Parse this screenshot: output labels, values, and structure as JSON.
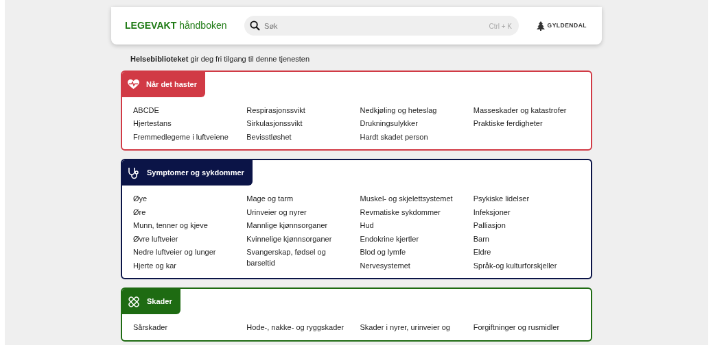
{
  "header": {
    "logo_bold": "LEGEVAKT",
    "logo_light": "håndboken",
    "search": {
      "placeholder": "Søk",
      "shortcut": "Ctrl + K"
    },
    "publisher": "GYLDENDAL"
  },
  "notice": "**Helsebiblioteket** gir deg fri tilgang til denne tjenesten",
  "sections": [
    {
      "title": "Når det haster",
      "kind": "urgent",
      "color": "#d13a45",
      "columns": [
        [
          "ABCDE",
          "Hjertestans",
          "Fremmedlegeme i luftveiene"
        ],
        [
          "Respirasjonssvikt",
          "Sirkulasjonssvikt",
          "Bevisstløshet"
        ],
        [
          "Nedkjøling og heteslag",
          "Drukningsulykker",
          "Hardt skadet person"
        ],
        [
          "Masseskader og katastrofer",
          "Praktiske ferdigheter"
        ]
      ]
    },
    {
      "title": "Symptomer og sykdommer",
      "kind": "symptoms",
      "color": "#0b1447",
      "columns": [
        [
          "Øye",
          "Øre",
          "Munn, tenner og kjeve",
          "Øvre luftveier",
          "Nedre luftveier og lunger",
          "Hjerte og kar"
        ],
        [
          "Mage og tarm",
          "Urinveier og nyrer",
          "Mannlige kjønnsorganer",
          "Kvinnelige kjønnsorganer",
          "Svangerskap, fødsel og barseltid"
        ],
        [
          "Muskel- og skjelettsystemet",
          "Revmatiske sykdommer",
          "Hud",
          "Endokrine kjertler",
          "Blod og lymfe",
          "Nervesystemet"
        ],
        [
          "Psykiske lidelser",
          "Infeksjoner",
          "Palliasjon",
          "Barn",
          "Eldre",
          "Språk-og kulturforskjeller"
        ]
      ]
    },
    {
      "title": "Skader",
      "kind": "injuries",
      "color": "#1e6b12",
      "columns": [
        [
          "Sårskader"
        ],
        [
          "Hode-, nakke- og ryggskader"
        ],
        [
          "Skader i nyrer, urinveier og"
        ],
        [
          "Forgiftninger og rusmidler"
        ]
      ]
    }
  ]
}
